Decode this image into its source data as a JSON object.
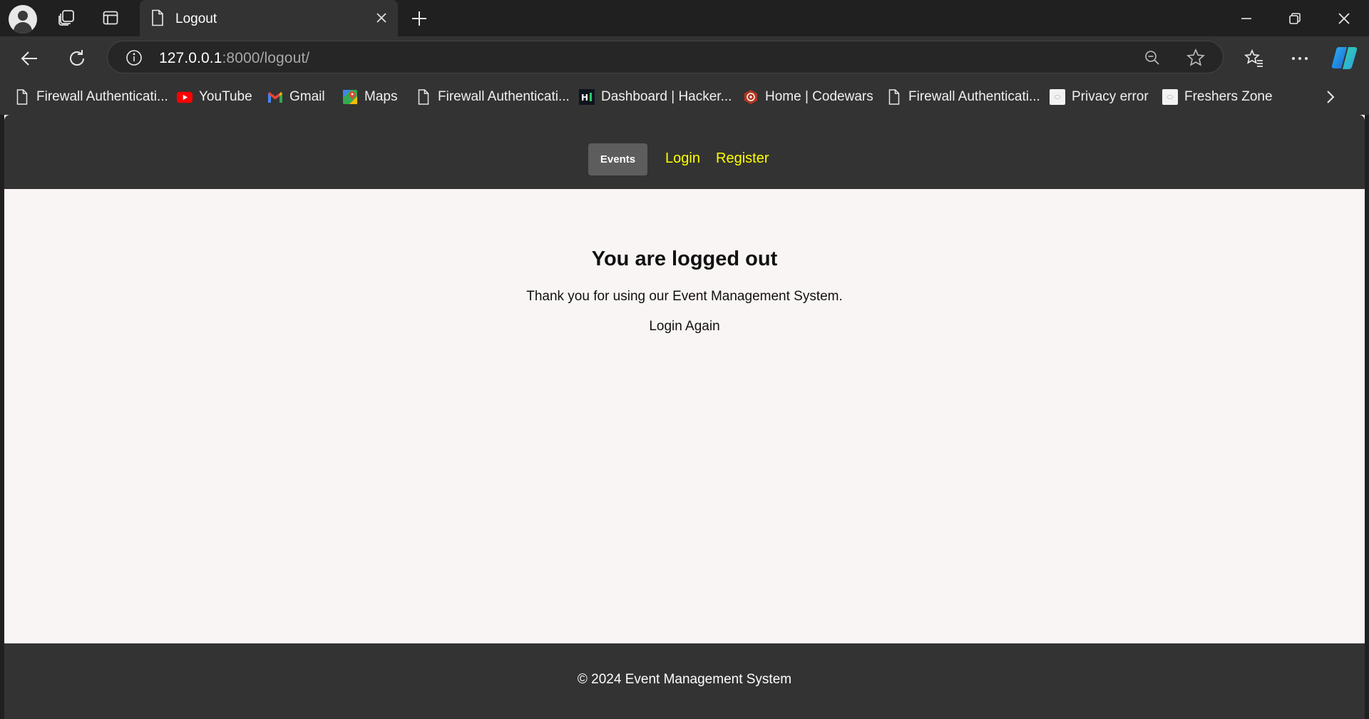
{
  "browser": {
    "tab": {
      "title": "Logout"
    },
    "address": {
      "host": "127.0.0.1",
      "path": ":8000/logout/"
    },
    "bookmarks": [
      {
        "label": "Firewall Authenticati...",
        "icon": "page-icon"
      },
      {
        "label": "YouTube",
        "icon": "youtube-icon"
      },
      {
        "label": "Gmail",
        "icon": "gmail-icon"
      },
      {
        "label": "Maps",
        "icon": "maps-icon"
      },
      {
        "label": "Firewall Authenticati...",
        "icon": "page-icon"
      },
      {
        "label": "Dashboard | Hacker...",
        "icon": "hackerrank-icon"
      },
      {
        "label": "Home | Codewars",
        "icon": "codewars-icon"
      },
      {
        "label": "Firewall Authenticati...",
        "icon": "page-icon"
      },
      {
        "label": "Privacy error",
        "icon": "blank-page-icon"
      },
      {
        "label": "Freshers Zone",
        "icon": "blank-page-icon"
      }
    ]
  },
  "site": {
    "nav": {
      "events": "Events",
      "login": "Login",
      "register": "Register"
    },
    "main": {
      "title": "You are logged out",
      "message": "Thank you for using our Event Management System.",
      "login_again": "Login Again"
    },
    "footer": {
      "text": "© 2024 Event Management System"
    }
  },
  "colors": {
    "nav_link": "#ffff00",
    "header_bg": "#333333",
    "page_bg": "#f9f5f4",
    "events_button_bg": "#5d5d5d"
  }
}
